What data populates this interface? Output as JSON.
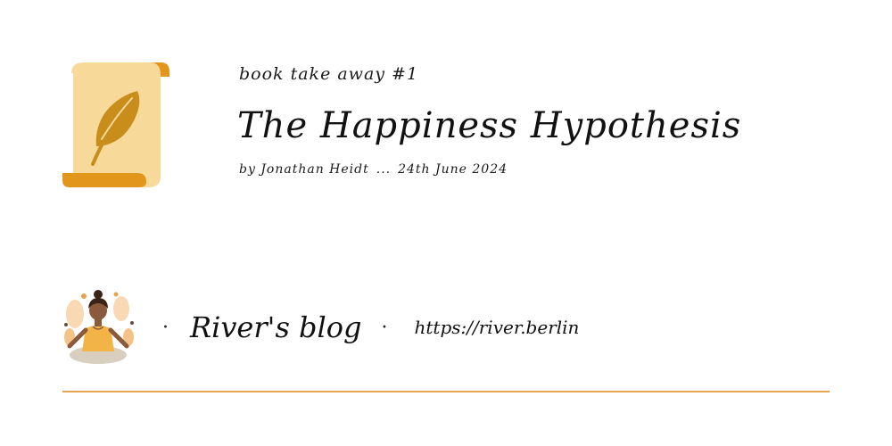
{
  "header": {
    "series_label": "book take away #1",
    "title": "The Happiness Hypothesis",
    "author": "by Jonathan Heidt",
    "separator": "...",
    "date": "24th June 2024"
  },
  "footer": {
    "dot_left": "·",
    "blog_name": "River's blog",
    "dot_right": "·",
    "url": "https://river.berlin"
  },
  "icons": {
    "scroll": "scroll-feather-icon",
    "avatar": "meditating-person-avatar"
  },
  "colors": {
    "accent_orange": "#e2961b",
    "scroll_paper": "#f7d99a",
    "feather": "#c88d1a",
    "rule": "#e5a550"
  }
}
